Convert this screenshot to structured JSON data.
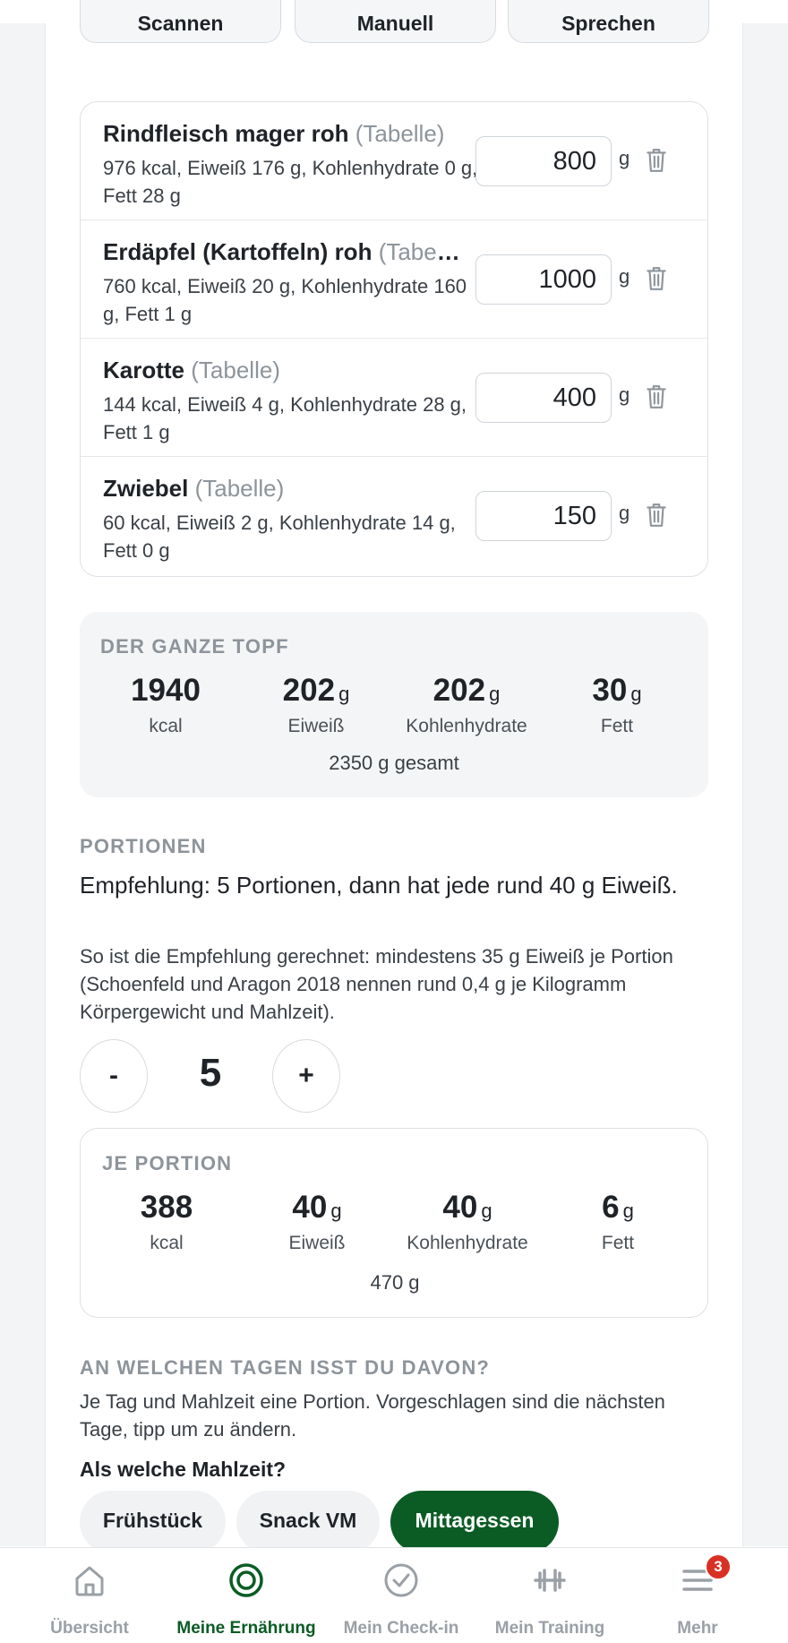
{
  "actions": {
    "scan": "Scannen",
    "manual": "Manuell",
    "speak": "Sprechen"
  },
  "ingredients": [
    {
      "name": "Rindfleisch mager roh",
      "source": "(Tabelle)",
      "desc": "976 kcal, Eiweiß 176 g, Kohlenhydrate 0 g, Fett 28 g",
      "amount": "800",
      "unit": "g"
    },
    {
      "name": "Erdäpfel (Kartoffeln) roh",
      "source": "(Tabelle)",
      "desc": "760 kcal, Eiweiß 20 g, Kohlenhydrate 160 g, Fett 1 g",
      "amount": "1000",
      "unit": "g"
    },
    {
      "name": "Karotte",
      "source": "(Tabelle)",
      "desc": "144 kcal, Eiweiß 4 g, Kohlenhydrate 28 g, Fett 1 g",
      "amount": "400",
      "unit": "g"
    },
    {
      "name": "Zwiebel",
      "source": "(Tabelle)",
      "desc": "60 kcal, Eiweiß 2 g, Kohlenhydrate 14 g, Fett 0 g",
      "amount": "150",
      "unit": "g"
    }
  ],
  "pot": {
    "label": "DER GANZE TOPF",
    "kcal": "1940",
    "kcal_label": "kcal",
    "protein": "202",
    "protein_unit": "g",
    "protein_label": "Eiweiß",
    "carbs": "202",
    "carbs_unit": "g",
    "carbs_label": "Kohlenhydrate",
    "fat": "30",
    "fat_unit": "g",
    "fat_label": "Fett",
    "total": "2350 g gesamt"
  },
  "portions": {
    "label": "PORTIONEN",
    "recommendation": "Empfehlung: 5 Portionen, dann hat jede rund 40 g Eiweiß.",
    "explanation": "So ist die Empfehlung gerechnet: mindestens 35 g Eiweiß je Portion (Schoenfeld und Aragon 2018 nennen rund 0,4 g je Kilogramm Körpergewicht und Mahlzeit).",
    "minus": "-",
    "plus": "+",
    "count": "5"
  },
  "per_portion": {
    "label": "JE PORTION",
    "kcal": "388",
    "kcal_label": "kcal",
    "protein": "40",
    "protein_unit": "g",
    "protein_label": "Eiweiß",
    "carbs": "40",
    "carbs_unit": "g",
    "carbs_label": "Kohlenhydrate",
    "fat": "6",
    "fat_unit": "g",
    "fat_label": "Fett",
    "weight": "470 g"
  },
  "days": {
    "label": "AN WELCHEN TAGEN ISST DU DAVON?",
    "text": "Je Tag und Mahlzeit eine Portion. Vorgeschlagen sind die nächsten Tage, tipp um zu ändern.",
    "meal_question": "Als welche Mahlzeit?",
    "meals": [
      "Frühstück",
      "Snack VM",
      "Mittagessen"
    ]
  },
  "nav": {
    "overview": "Übersicht",
    "nutrition": "Meine Ernährung",
    "checkin": "Mein Check-in",
    "training": "Mein Training",
    "more": "Mehr",
    "more_badge": "3"
  },
  "colors": {
    "accent": "#0a5c24",
    "badge": "#d93025"
  }
}
